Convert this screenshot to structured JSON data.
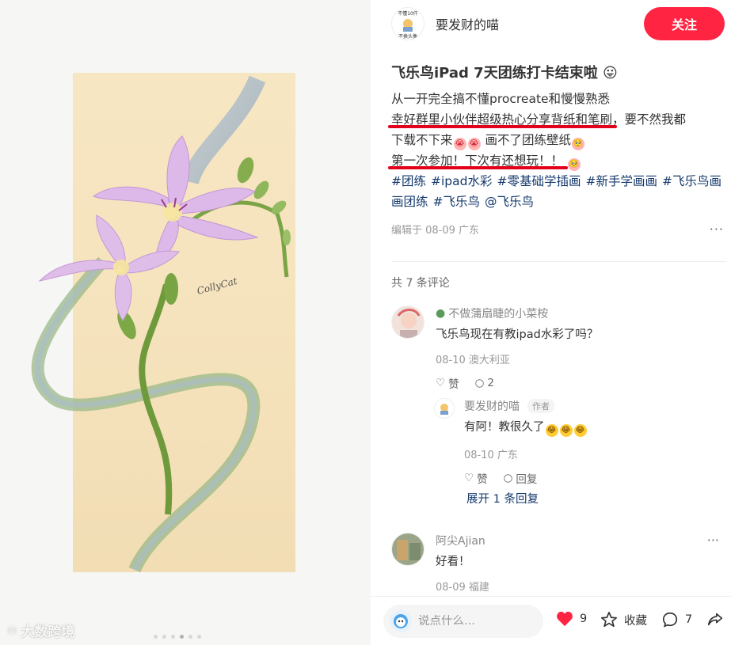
{
  "author": {
    "name": "要发财的喵",
    "avatar_text_top": "不懂10仟",
    "avatar_text_bottom": "不换头像"
  },
  "follow_label": "关注",
  "watermark": {
    "text": "大数跨境"
  },
  "note": {
    "title": "飞乐鸟iPad 7天团练打卡结束啦",
    "title_emoji": "😛",
    "line1": "从一开完全搞不懂procreate和慢慢熟悉",
    "line2_underlined": "幸好群里小伙伴超级热心分享背纸和笔刷",
    "line2_rest": "，要不然我都",
    "line3": "下载不下来",
    "line3_rest": "画不了团练壁纸",
    "line4_underlined": "第一次参加！下次有还想玩！！",
    "tags": [
      "#团练",
      "#ipad水彩",
      "#零基础学插画",
      "#新手学画画",
      "#飞乐鸟画画团练",
      "#飞乐鸟",
      "@飞乐鸟"
    ],
    "meta": "编辑于 08-09 广东"
  },
  "comments": {
    "count_label": "共 7 条评论",
    "items": [
      {
        "name": "不做蒲扇睫的小菜桉",
        "text": "飞乐鸟现在有教ipad水彩了吗？",
        "meta": "08-10 澳大利亚",
        "like_label": "赞",
        "reply_count": "2",
        "reply": {
          "name": "要发财的喵",
          "badge": "作者",
          "text": "有阿！教很久了",
          "meta": "08-10 广东",
          "like_label": "赞",
          "reply_label": "回复"
        },
        "expand_label": "展开 1 条回复"
      },
      {
        "name": "阿尖Ajian",
        "text": "好看！",
        "meta": "08-09 福建"
      }
    ]
  },
  "bottom": {
    "placeholder": "说点什么...",
    "likes": "9",
    "collect_label": "收藏",
    "comments": "7"
  },
  "colors": {
    "accent": "#ff2442",
    "tag": "#13386c",
    "underline": "#e3001b"
  }
}
